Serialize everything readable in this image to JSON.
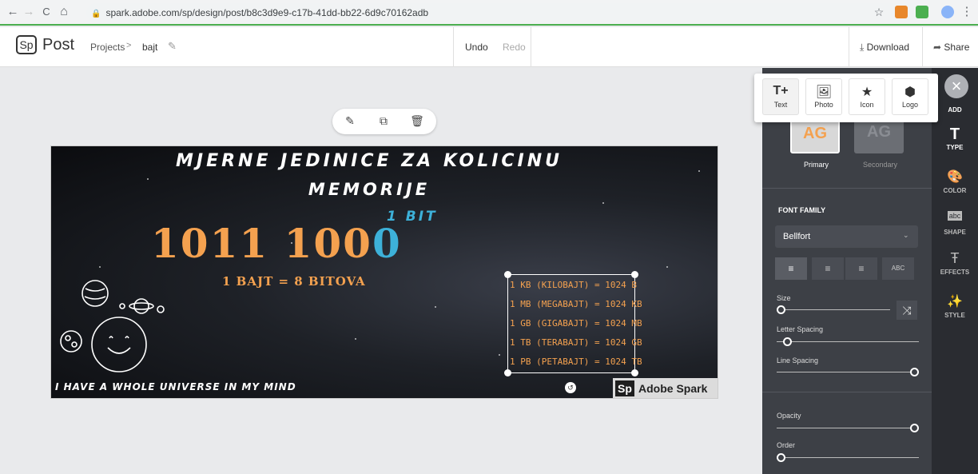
{
  "browser": {
    "url": "spark.adobe.com/sp/design/post/b8c3d9e9-c17b-41dd-bb22-6d9c70162adb",
    "back_icon": "←",
    "forward_icon": "→",
    "reload_icon": "C",
    "home_icon": "⌂",
    "lock_icon": "🔒",
    "star_icon": "☆",
    "menu_icon": "⋮"
  },
  "header": {
    "logo_sp": "Sp",
    "logo_post": "Post",
    "breadcrumb_projects": "Projects",
    "breadcrumb_sep": ">",
    "project_name": "bajt",
    "undo": "Undo",
    "redo": "Redo",
    "download": "Download",
    "share": "Share"
  },
  "canvas_toolbar": {
    "edit_icon": "✎",
    "duplicate_icon": "⧉",
    "delete_icon": "🗑"
  },
  "design": {
    "title_line1": "MJERNE JEDINICE ZA KOLICINU",
    "title_line2": "MEMORIJE",
    "bits_prefix": "1011 100",
    "bits_highlight": "0",
    "one_bit_label": "1 BIT",
    "bajt_eq": "1 BAJT = 8 BITOVA",
    "units": [
      "1 KB (KILOBAJT) = 1024 B",
      "1 MB (MEGABAJT) = 1024 KB",
      "1 GB (GIGABAJT) = 1024 MB",
      "1 TB (TERABAJT) = 1024 GB",
      "1 PB (PETABAJT) = 1024 TB"
    ],
    "footer_text": "I HAVE A WHOLE UNIVERSE IN MY MIND",
    "watermark_sp": "Sp",
    "watermark_text": "Adobe Spark"
  },
  "add_popup": {
    "items": [
      {
        "label": "Text",
        "icon": "T+"
      },
      {
        "label": "Photo",
        "icon": "🖼"
      },
      {
        "label": "Icon",
        "icon": "★"
      },
      {
        "label": "Logo",
        "icon": "⬢"
      }
    ]
  },
  "panel": {
    "swatch_text": "AG",
    "primary_label": "Primary",
    "secondary_label": "Secondary",
    "font_family_label": "FONT FAMILY",
    "font_family_value": "Bellfort",
    "align_left": "≡",
    "align_center": "≡",
    "align_right": "≡",
    "align_caps": "ABC",
    "size_label": "Size",
    "letter_spacing_label": "Letter Spacing",
    "line_spacing_label": "Line Spacing",
    "opacity_label": "Opacity",
    "order_label": "Order",
    "shuffle_icon": "⤨",
    "size_value": 0,
    "letter_spacing_value": 0.05,
    "line_spacing_value": 1.0,
    "opacity_value": 1.0,
    "order_value": 0
  },
  "sidebar": {
    "close_icon": "×",
    "add": "ADD",
    "type": "TYPE",
    "color": "COLOR",
    "shape": "SHAPE",
    "effects": "EFFECTS",
    "style": "STYLE",
    "type_icon": "T",
    "color_icon": "🎨",
    "shape_icon": "abc",
    "effects_icon": "Ŧ",
    "style_icon": "✨"
  },
  "colors": {
    "accent_orange": "#f4a14f",
    "accent_blue": "#3db1d9",
    "panel_bg": "#3d4046",
    "sidebar_bg": "#2a2c31"
  }
}
